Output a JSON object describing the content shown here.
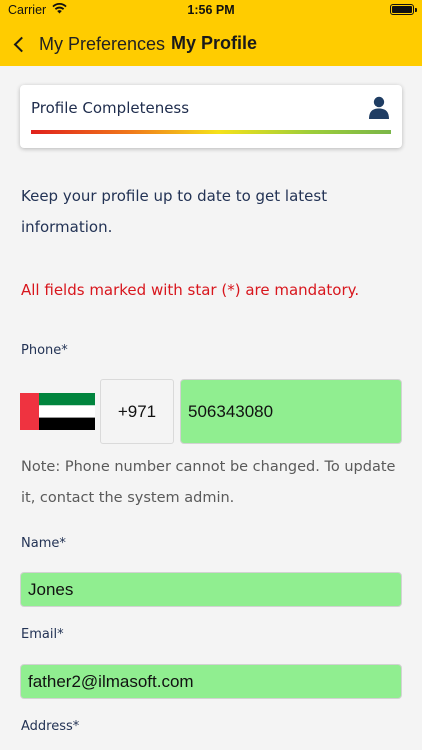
{
  "status_bar": {
    "carrier": "Carrier",
    "time": "1:56 PM"
  },
  "nav": {
    "back_label": "My Preferences",
    "title": "My Profile"
  },
  "profile_card": {
    "title": "Profile Completeness"
  },
  "intro_text": "Keep your profile up to date to get latest information.",
  "mandatory_text": "All fields marked with star (*) are mandatory.",
  "phone": {
    "label": "Phone*",
    "country_code": "+971",
    "number": "506343080",
    "note": "Note: Phone number cannot be changed. To update it, contact the system admin."
  },
  "name": {
    "label": "Name*",
    "value": "Jones"
  },
  "email": {
    "label": "Email*",
    "value": "father2@ilmasoft.com"
  },
  "address": {
    "label": "Address*"
  },
  "colors": {
    "header": "#ffcc00",
    "field_bg": "#90ee90",
    "mandatory": "#d8161d",
    "text": "#233355"
  }
}
